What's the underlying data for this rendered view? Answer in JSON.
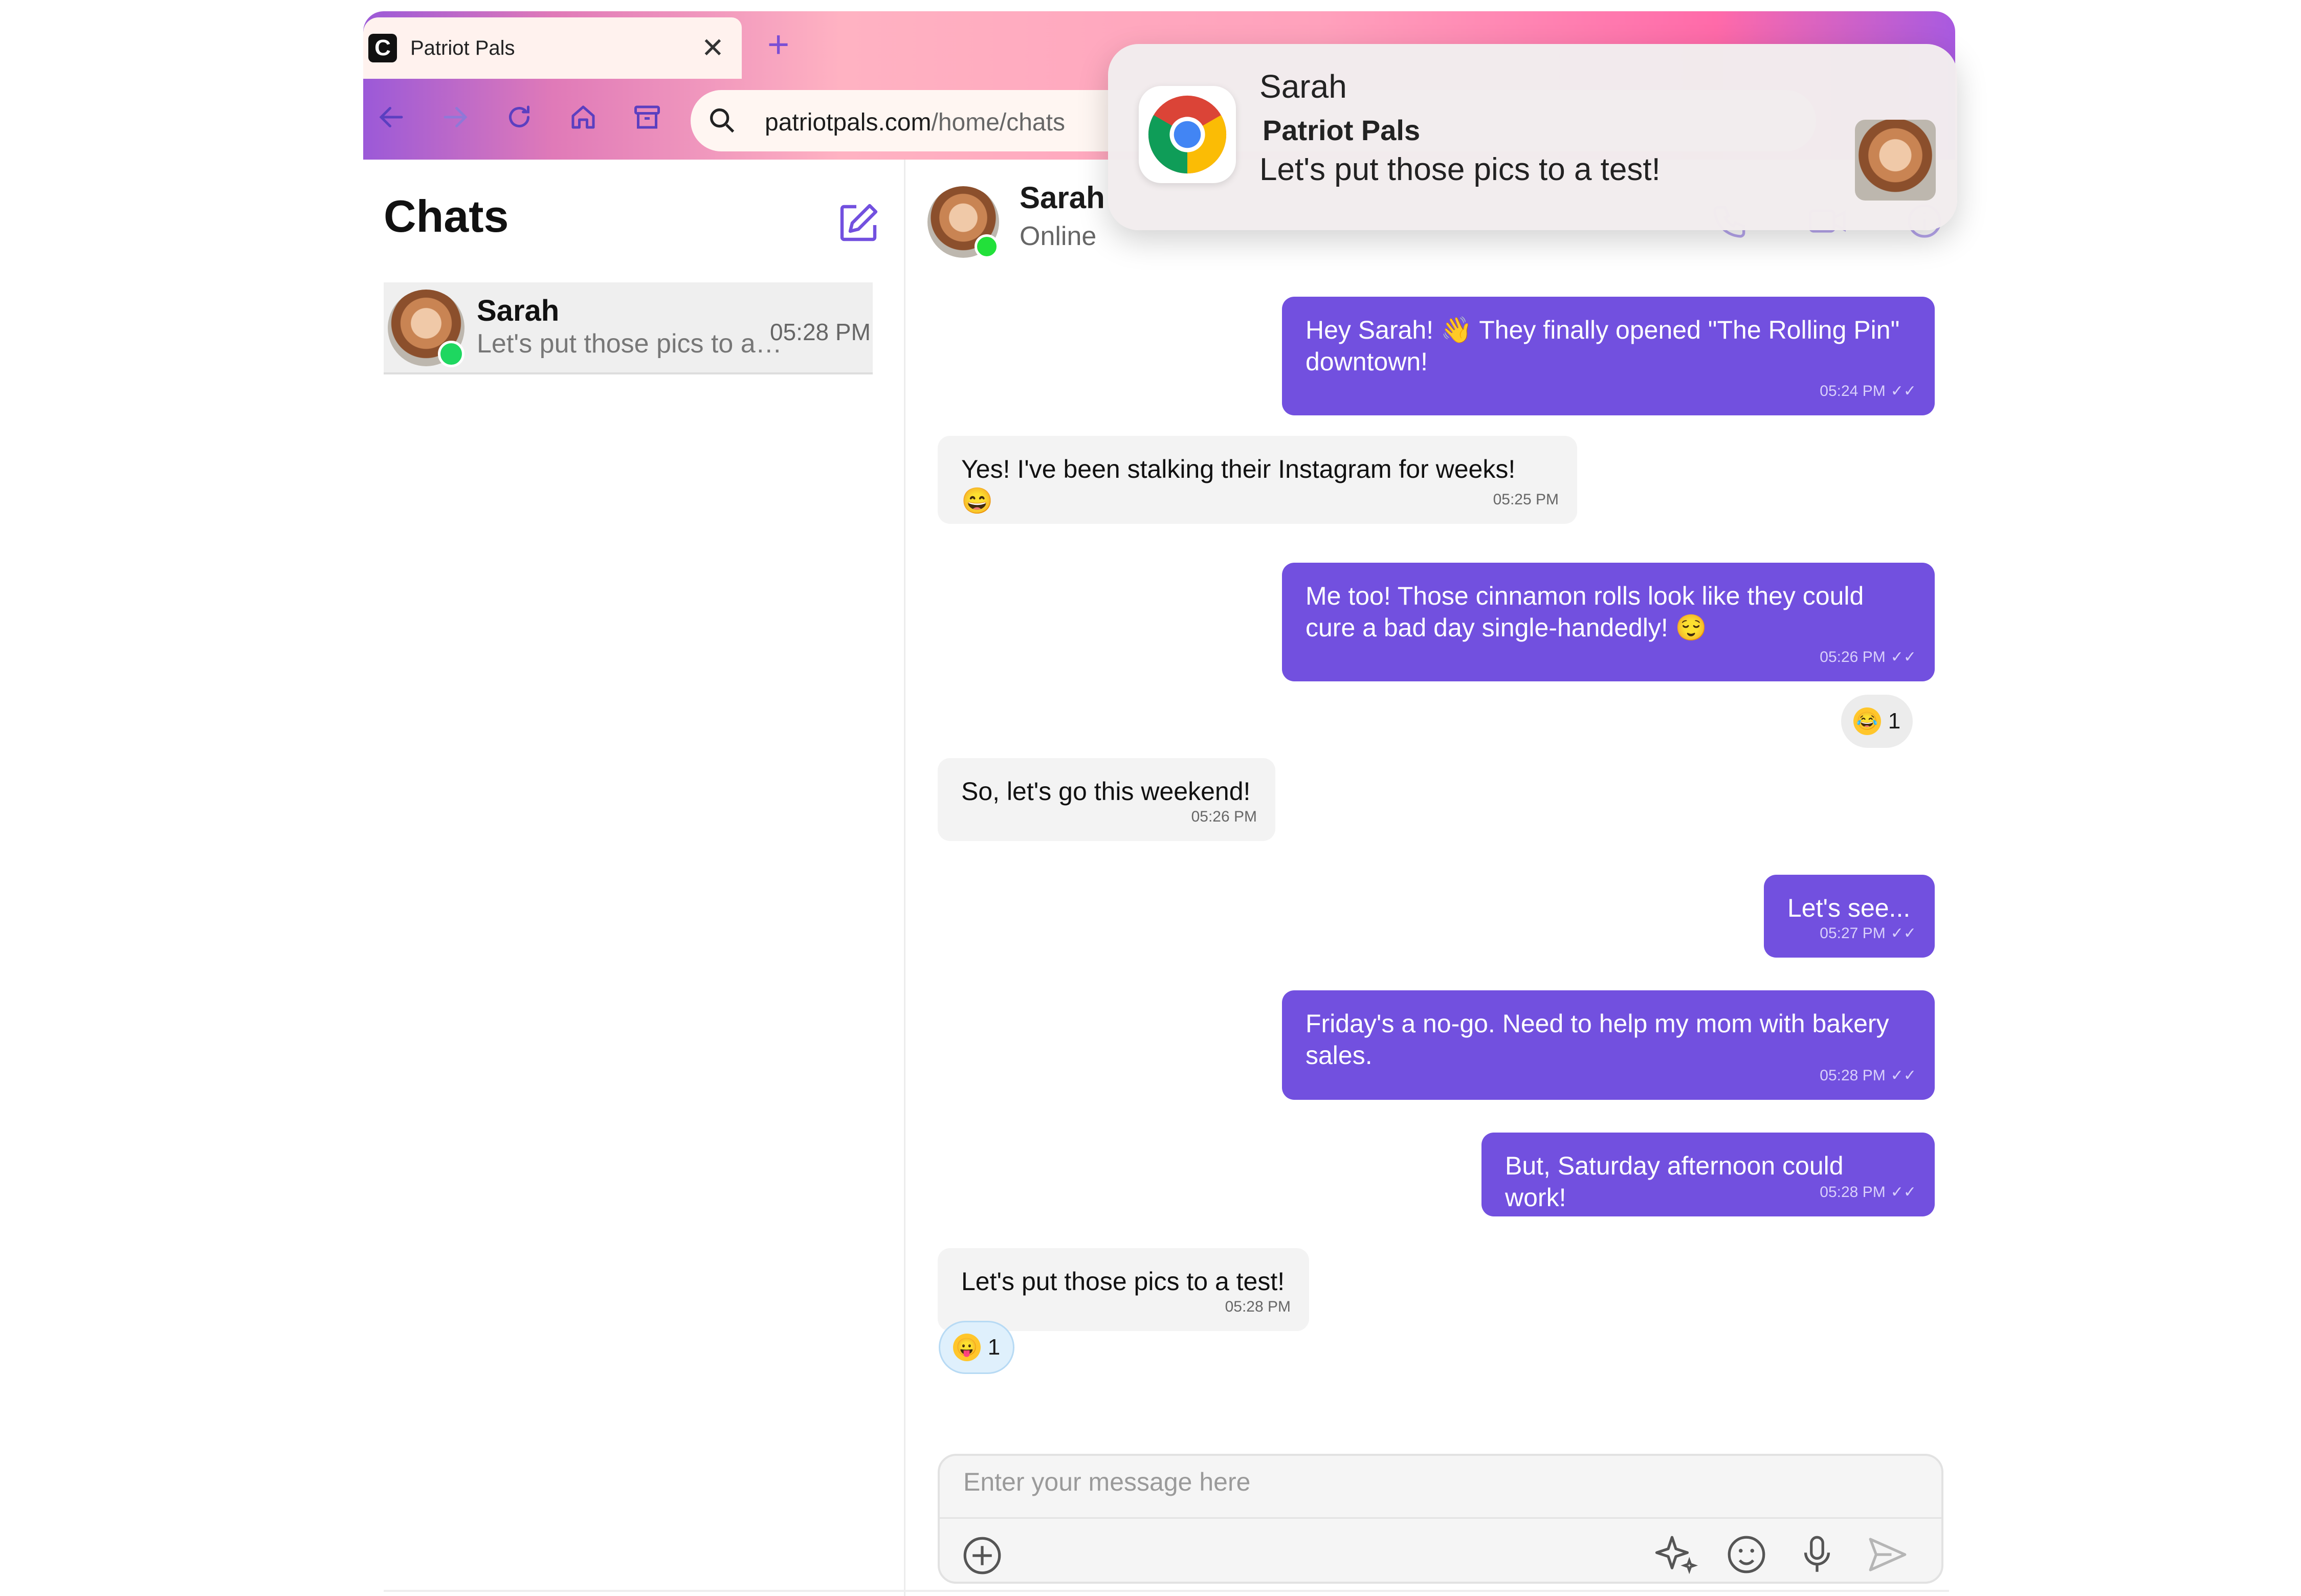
{
  "browser": {
    "tab_title": "Patriot Pals",
    "favicon_letter": "C",
    "url_domain": "patriotpals.com",
    "url_path": "/home/chats",
    "close_glyph": "✕",
    "newtab_glyph": "+"
  },
  "sidebar": {
    "title": "Chats",
    "chats": [
      {
        "name": "Sarah",
        "preview": "Let's put those pics to a test!",
        "time": "05:28 PM",
        "online": true
      }
    ]
  },
  "conversation": {
    "contact_name": "Sarah",
    "contact_status": "Online",
    "messages": [
      {
        "dir": "out",
        "text": "Hey Sarah! 👋 They finally opened \"The Rolling Pin\" downtown!",
        "time": "05:24 PM",
        "read": true
      },
      {
        "dir": "in",
        "text": "Yes! I've been stalking their Instagram for weeks! 😄",
        "time": "05:25 PM"
      },
      {
        "dir": "out",
        "text": "Me too! Those cinnamon rolls look like they could cure a bad day single-handedly! 😌",
        "time": "05:26 PM",
        "read": true,
        "reaction": {
          "emoji": "😂",
          "count": "1"
        }
      },
      {
        "dir": "in",
        "text": "So, let's go this weekend!",
        "time": "05:26 PM"
      },
      {
        "dir": "out",
        "text": "Let's see...",
        "time": "05:27 PM",
        "read": true
      },
      {
        "dir": "out",
        "text": "Friday's a no-go. Need to help my mom with bakery sales.",
        "time": "05:28 PM",
        "read": true
      },
      {
        "dir": "out",
        "text": "But, Saturday afternoon could work!",
        "time": "05:28 PM",
        "read": true
      },
      {
        "dir": "in",
        "text": "Let's put those pics to a test!",
        "time": "05:28 PM",
        "reaction": {
          "emoji": "😛",
          "count": "1"
        }
      }
    ]
  },
  "composer": {
    "placeholder": "Enter your message here"
  },
  "notification": {
    "title": "Sarah",
    "app_name": "Patriot Pals",
    "body": "Let's put those pics to a test!",
    "icon": "chrome-icon"
  },
  "colors": {
    "accent": "#7250df",
    "online": "#1ed760",
    "incoming_bubble": "#f3f3f3"
  }
}
